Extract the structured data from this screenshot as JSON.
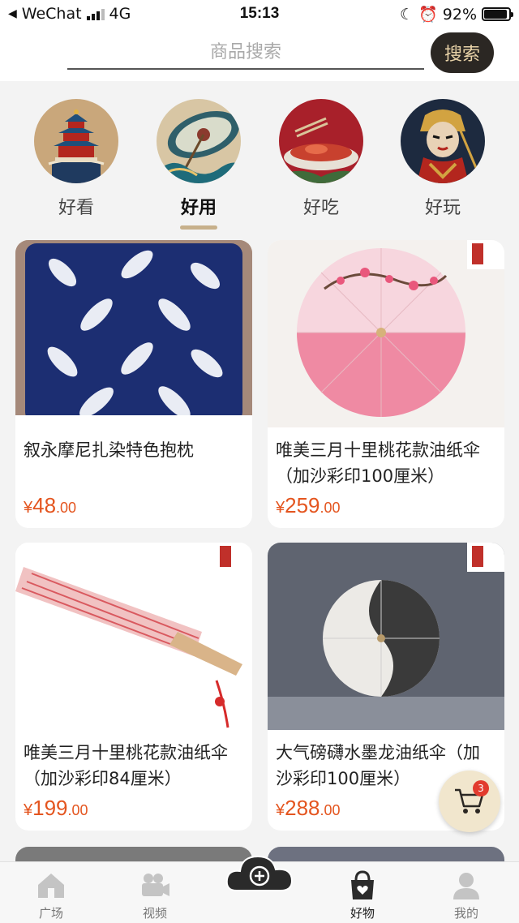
{
  "status_bar": {
    "carrier": "WeChat",
    "network": "4G",
    "time": "15:13",
    "battery": "92%",
    "battery_level": 0.92
  },
  "search": {
    "placeholder": "商品搜索",
    "button_label": "搜索"
  },
  "categories": [
    {
      "label": "好看",
      "icon": "temple-icon",
      "active": false
    },
    {
      "label": "好用",
      "icon": "umbrella-icon",
      "active": true
    },
    {
      "label": "好吃",
      "icon": "food-icon",
      "active": false
    },
    {
      "label": "好玩",
      "icon": "opera-icon",
      "active": false
    }
  ],
  "products": [
    {
      "title": "叙永摩尼扎染特色抱枕",
      "currency": "¥",
      "price_int": "48",
      "price_dec": ".00",
      "image": "tie-dye-pillow"
    },
    {
      "title": "唯美三月十里桃花款油纸伞（加沙彩印100厘米）",
      "currency": "¥",
      "price_int": "259",
      "price_dec": ".00",
      "image": "peach-blossom-umbrella"
    },
    {
      "title": "唯美三月十里桃花款油纸伞（加沙彩印84厘米）",
      "currency": "¥",
      "price_int": "199",
      "price_dec": ".00",
      "image": "closed-umbrella"
    },
    {
      "title": "大气磅礴水墨龙油纸伞（加沙彩印100厘米）",
      "currency": "¥",
      "price_int": "288",
      "price_dec": ".00",
      "image": "ink-dragon-umbrella"
    }
  ],
  "cart": {
    "badge": "3"
  },
  "tabbar": {
    "items": [
      {
        "label": "广场",
        "icon": "home-icon",
        "active": false
      },
      {
        "label": "视频",
        "icon": "video-camera-icon",
        "active": false
      },
      {
        "label": "好物",
        "icon": "gift-bag-icon",
        "active": true
      },
      {
        "label": "我的",
        "icon": "user-icon",
        "active": false
      }
    ],
    "publish_icon": "plus-cloud-icon"
  },
  "colors": {
    "accent": "#e4551f",
    "button_bg": "#2b2723",
    "button_text": "#e9d3a8",
    "underline": "#c7b08b"
  }
}
